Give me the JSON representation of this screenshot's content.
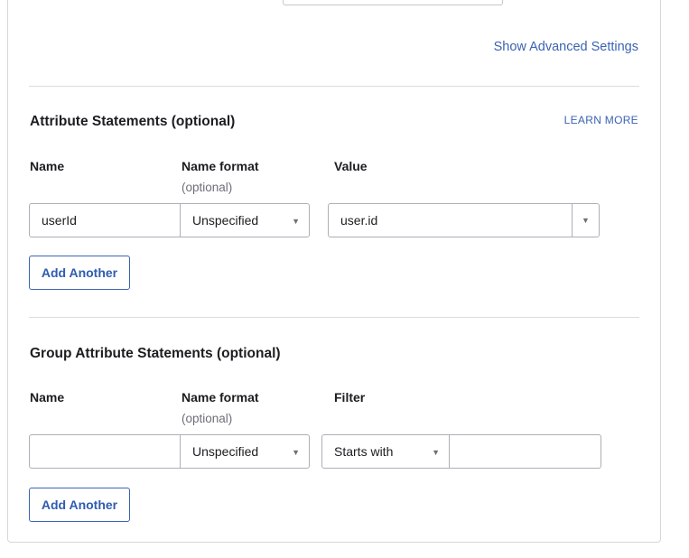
{
  "advanced": {
    "show_advanced_label": "Show Advanced Settings"
  },
  "attribute_statements": {
    "title": "Attribute Statements (optional)",
    "learn_more_label": "LEARN MORE",
    "columns": {
      "name": "Name",
      "name_format": "Name format",
      "name_format_hint": "(optional)",
      "value": "Value"
    },
    "row": {
      "name_value": "userId",
      "name_format_value": "Unspecified",
      "value_value": "user.id"
    },
    "add_another_label": "Add Another"
  },
  "group_attribute_statements": {
    "title": "Group Attribute Statements (optional)",
    "columns": {
      "name": "Name",
      "name_format": "Name format",
      "name_format_hint": "(optional)",
      "filter": "Filter"
    },
    "row": {
      "name_value": "",
      "name_format_value": "Unspecified",
      "filter_type_value": "Starts with",
      "filter_value": ""
    },
    "add_another_label": "Add Another"
  },
  "icons": {
    "dropdown": "caret-down-icon"
  },
  "colors": {
    "link": "#3b63b4",
    "border": "#aeaeb6",
    "divider": "#dcdce0"
  }
}
